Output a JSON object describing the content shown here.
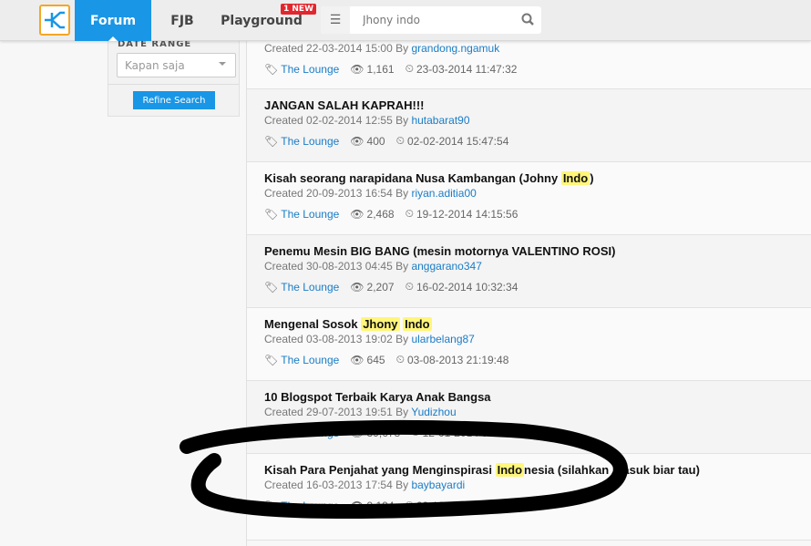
{
  "header": {
    "tabs": [
      {
        "label": "Forum",
        "active": true
      },
      {
        "label": "FJB"
      },
      {
        "label": "Playground",
        "badge": "1 NEW"
      }
    ],
    "search": {
      "value": "Jhony indo"
    },
    "accent": "#1996e6"
  },
  "sidebar": {
    "date_range_label": "DATE RANGE",
    "date_range_value": "Kapan saja",
    "refine_label": "Refine Search"
  },
  "threads": [
    {
      "title": "",
      "created": "Created 22-03-2014 15:00 By ",
      "author": "grandong.ngamuk",
      "category": "The Lounge",
      "views": "1,161",
      "last": "23-03-2014 11:47:32"
    },
    {
      "title": "JANGAN SALAH KAPRAH!!!",
      "created": "Created 02-02-2014 12:55 By ",
      "author": "hutabarat90",
      "category": "The Lounge",
      "views": "400",
      "last": "02-02-2014 15:47:54"
    },
    {
      "title_parts": [
        "Kisah seorang narapidana Nusa Kambangan (Johny ",
        "Indo",
        ")"
      ],
      "created": "Created 20-09-2013 16:54 By ",
      "author": "riyan.aditia00",
      "category": "The Lounge",
      "views": "2,468",
      "last": "19-12-2014 14:15:56"
    },
    {
      "title": "Penemu Mesin BIG BANG (mesin motornya VALENTINO ROSI)",
      "created": "Created 30-08-2013 04:45 By ",
      "author": "anggarano347",
      "category": "The Lounge",
      "views": "2,207",
      "last": "16-02-2014 10:32:34"
    },
    {
      "title_parts": [
        "Mengenal Sosok ",
        "Jhony",
        " ",
        "Indo",
        ""
      ],
      "created": "Created 03-08-2013 19:02 By ",
      "author": "ularbelang87",
      "category": "The Lounge",
      "views": "645",
      "last": "03-08-2013 21:19:48"
    },
    {
      "title": "10 Blogspot Terbaik Karya Anak Bangsa",
      "created": "Created 29-07-2013 19:51 By ",
      "author": "Yudizhou",
      "category": "The Lounge",
      "views": "39,678",
      "last": "12-01-2014 08:06:52"
    },
    {
      "title_parts": [
        "Kisah Para Penjahat yang Menginspirasi ",
        "Indo",
        "nesia (silahkan masuk biar tau)"
      ],
      "created": "Created 16-03-2013 17:54 By ",
      "author": "baybayardi",
      "category": "The Lounge",
      "views": "9,194",
      "last": "09-12-2014 17:36:45"
    }
  ]
}
